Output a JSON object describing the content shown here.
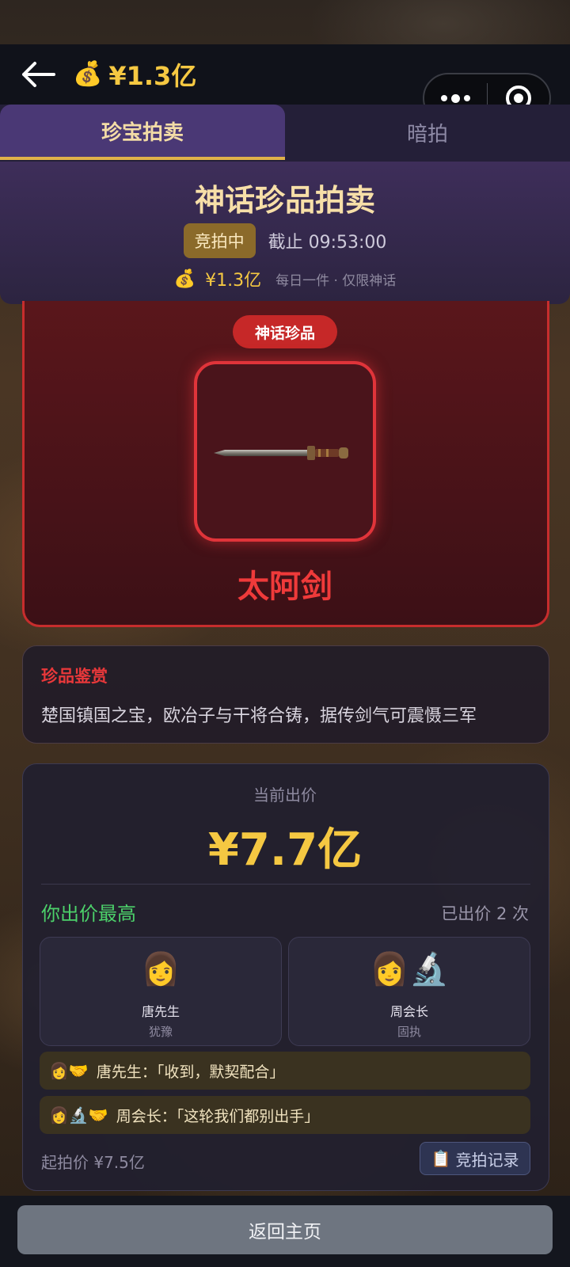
{
  "header": {
    "balance_icon": "money-bag-icon",
    "balance": "¥1.3亿",
    "menu_icon": "more-dots-icon",
    "close_icon": "target-circle-icon"
  },
  "tabs": [
    {
      "label": "珍宝拍卖",
      "active": true
    },
    {
      "label": "暗拍",
      "active": false
    }
  ],
  "auction": {
    "title": "神话珍品拍卖",
    "status": "竞拍中",
    "deadline": "截止 09:53:00",
    "balance": "¥1.3亿",
    "rule": "每日一件 · 仅限神话"
  },
  "item": {
    "badge": "神话珍品",
    "name": "太阿剑",
    "icon": "bronze-sword-icon"
  },
  "description": {
    "title": "珍品鉴赏",
    "text": "楚国镇国之宝，欧冶子与干将合铸，据传剑气可震慑三军"
  },
  "bid": {
    "label": "当前出价",
    "current_price": "¥7.7亿",
    "status_text": "你出价最高",
    "bid_count": "已出价 2 次",
    "bidders": [
      {
        "emoji": "👩",
        "name": "唐先生",
        "trait": "犹豫"
      },
      {
        "emoji": "👩🔬",
        "name": "周会长",
        "trait": "固执"
      }
    ],
    "messages": [
      {
        "emoji": "👩🤝",
        "text": "唐先生：「收到，默契配合」"
      },
      {
        "emoji": "👩🔬🤝",
        "text": "周会长：「这轮我们都别出手」"
      }
    ],
    "start_price": "起拍价 ¥7.5亿",
    "record_icon": "📋",
    "record_label": "竞拍记录"
  },
  "footer": {
    "home_label": "返回主页"
  },
  "colors": {
    "accent_gold": "#f5c842",
    "myth_red": "#e0343a",
    "lead_green": "#4cd16a",
    "tab_purple": "#4a3875"
  }
}
